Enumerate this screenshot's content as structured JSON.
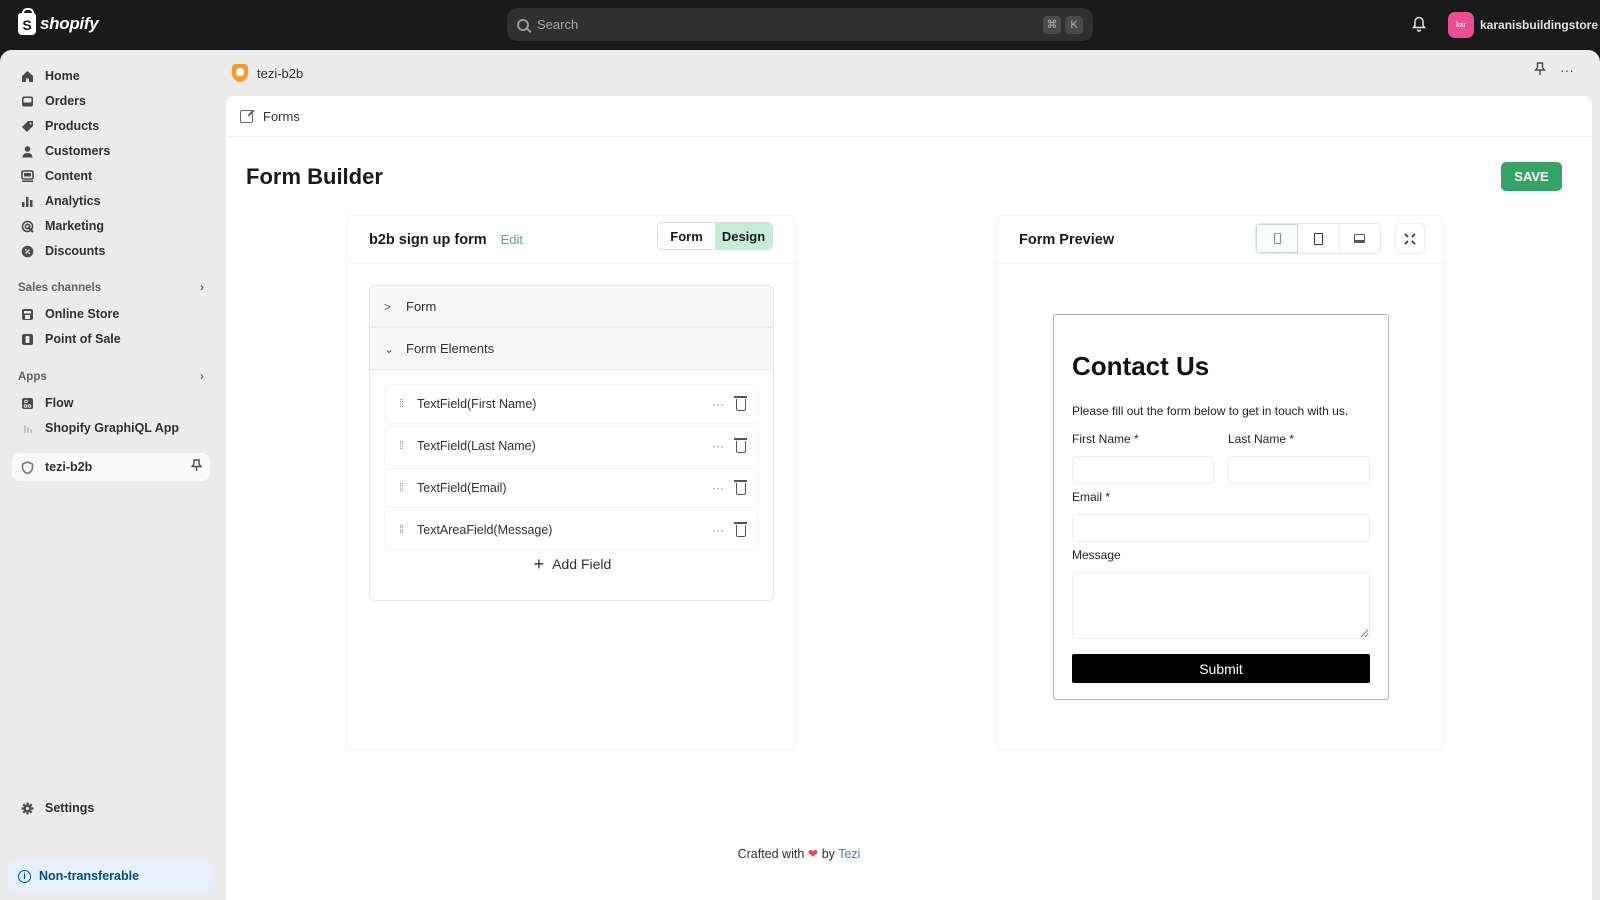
{
  "topbar": {
    "brand": "shopify",
    "search_placeholder": "Search",
    "shortcut_keys": [
      "⌘",
      "K"
    ],
    "store_avatar_initials": "kar",
    "store_name": "karanisbuildingstore",
    "avatar_color": "#ec4f91"
  },
  "sidebar": {
    "items": [
      {
        "label": "Home",
        "icon": "home-icon"
      },
      {
        "label": "Orders",
        "icon": "inbox-icon"
      },
      {
        "label": "Products",
        "icon": "tag-icon"
      },
      {
        "label": "Customers",
        "icon": "person-icon"
      },
      {
        "label": "Content",
        "icon": "image-icon"
      },
      {
        "label": "Analytics",
        "icon": "bar-chart-icon"
      },
      {
        "label": "Marketing",
        "icon": "target-icon"
      },
      {
        "label": "Discounts",
        "icon": "discount-icon"
      }
    ],
    "sales_channels_label": "Sales channels",
    "sales_channels": [
      {
        "label": "Online Store",
        "icon": "store-icon"
      },
      {
        "label": "Point of Sale",
        "icon": "pos-icon"
      }
    ],
    "apps_label": "Apps",
    "apps": [
      {
        "label": "Flow",
        "icon": "flow-icon"
      },
      {
        "label": "Shopify GraphiQL App",
        "icon": "app-icon"
      }
    ],
    "active_app": "tezi-b2b",
    "settings_label": "Settings",
    "non_transferable_label": "Non-transferable"
  },
  "app_header": {
    "app_name": "tezi-b2b"
  },
  "breadcrumb": {
    "label": "Forms"
  },
  "page": {
    "title": "Form Builder",
    "save_label": "SAVE",
    "save_color": "#36a366"
  },
  "builder": {
    "form_name": "b2b sign up form",
    "edit_label": "Edit",
    "tabs": [
      {
        "label": "Form",
        "active": false
      },
      {
        "label": "Design",
        "active": true
      }
    ],
    "sections": [
      {
        "label": "Form",
        "expanded": false
      },
      {
        "label": "Form Elements",
        "expanded": true
      }
    ],
    "fields": [
      {
        "label": "TextField(First Name)"
      },
      {
        "label": "TextField(Last Name)"
      },
      {
        "label": "TextField(Email)"
      },
      {
        "label": "TextAreaField(Message)"
      }
    ],
    "add_field_label": "Add Field"
  },
  "preview": {
    "title": "Form Preview",
    "devices": [
      "mobile",
      "tablet",
      "desktop"
    ],
    "active_device": "mobile",
    "form": {
      "heading": "Contact Us",
      "description": "Please fill out the form below to get in touch with us.",
      "first_name_label": "First Name *",
      "last_name_label": "Last Name *",
      "email_label": "Email *",
      "message_label": "Message",
      "submit_label": "Submit"
    }
  },
  "footer": {
    "prefix": "Crafted with",
    "heart": "❤",
    "by": "by",
    "link": "Tezi"
  }
}
